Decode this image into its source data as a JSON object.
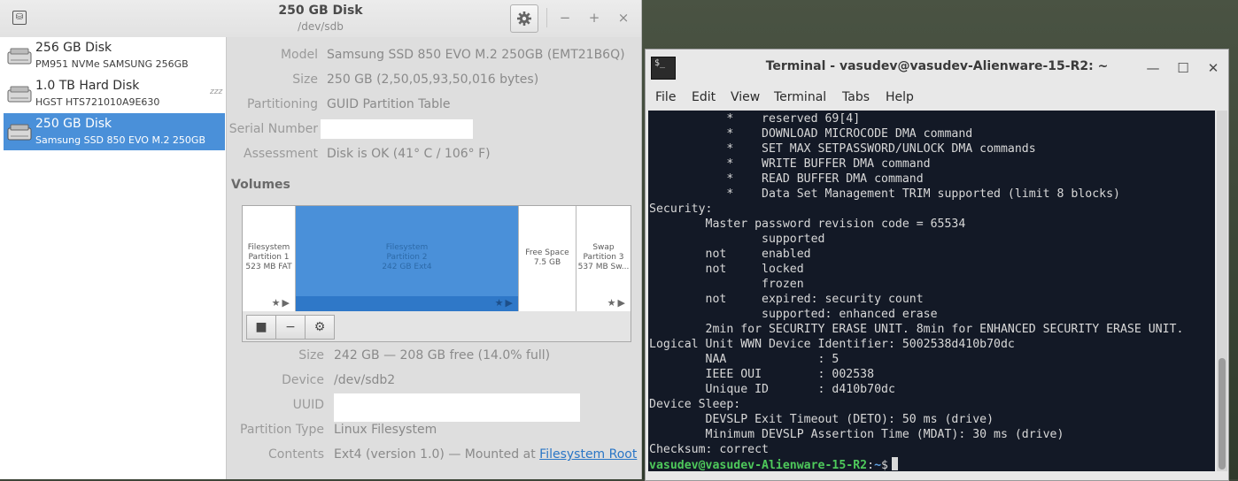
{
  "disks_window": {
    "title": "250 GB Disk",
    "subtitle": "/dev/sdb",
    "controls": {
      "minimize": "−",
      "maximize": "+",
      "close": "×"
    },
    "disk_list": [
      {
        "name": "256 GB Disk",
        "detail": "PM951 NVMe SAMSUNG 256GB"
      },
      {
        "name": "1.0 TB Hard Disk",
        "detail": "HGST HTS721010A9E630",
        "sleep_indicator": "zzz"
      },
      {
        "name": "250 GB Disk",
        "detail": "Samsung SSD 850 EVO M.2 250GB",
        "selected": true
      }
    ],
    "drive_properties": {
      "model_label": "Model",
      "model_value": "Samsung SSD 850 EVO M.2 250GB (EMT21B6Q)",
      "size_label": "Size",
      "size_value": "250 GB (2,50,05,93,50,016 bytes)",
      "partitioning_label": "Partitioning",
      "partitioning_value": "GUID Partition Table",
      "serial_label": "Serial Number",
      "assessment_label": "Assessment",
      "assessment_value": "Disk is OK (41° C / 106° F)"
    },
    "volumes_heading": "Volumes",
    "partitions": [
      {
        "line1": "Filesystem",
        "line2": "Partition 1",
        "line3": "523 MB FAT",
        "marks": "★▶"
      },
      {
        "line1": "Filesystem",
        "line2": "Partition 2",
        "line3": "242 GB Ext4",
        "marks": "★▶",
        "selected": true
      },
      {
        "line1": "Free Space",
        "line2": "7.5 GB",
        "line3": ""
      },
      {
        "line1": "Swap",
        "line2": "Partition 3",
        "line3": "537 MB Sw...",
        "marks": "★▶"
      }
    ],
    "volume_toolbar": {
      "stop": "■",
      "remove": "−",
      "options": "⚙"
    },
    "volume_properties": {
      "size_label": "Size",
      "size_value": "242 GB — 208 GB free (14.0% full)",
      "device_label": "Device",
      "device_value": "/dev/sdb2",
      "uuid_label": "UUID",
      "ptype_label": "Partition Type",
      "ptype_value": "Linux Filesystem",
      "contents_label": "Contents",
      "contents_value": "Ext4 (version 1.0) — Mounted at ",
      "contents_link": "Filesystem Root"
    }
  },
  "terminal_window": {
    "title": "Terminal - vasudev@vasudev-Alienware-15-R2: ~",
    "icon_text": "$_",
    "controls": {
      "minimize": "—",
      "maximize": "☐",
      "close": "✕"
    },
    "menu": [
      "File",
      "Edit",
      "View",
      "Terminal",
      "Tabs",
      "Help"
    ],
    "output_lines": [
      "           *    reserved 69[4]",
      "           *    DOWNLOAD MICROCODE DMA command",
      "           *    SET MAX SETPASSWORD/UNLOCK DMA commands",
      "           *    WRITE BUFFER DMA command",
      "           *    READ BUFFER DMA command",
      "           *    Data Set Management TRIM supported (limit 8 blocks)",
      "Security:",
      "        Master password revision code = 65534",
      "                supported",
      "        not     enabled",
      "        not     locked",
      "                frozen",
      "        not     expired: security count",
      "                supported: enhanced erase",
      "        2min for SECURITY ERASE UNIT. 8min for ENHANCED SECURITY ERASE UNIT.",
      "Logical Unit WWN Device Identifier: 5002538d410b70dc",
      "        NAA             : 5",
      "        IEEE OUI        : 002538",
      "        Unique ID       : d410b70dc",
      "Device Sleep:",
      "        DEVSLP Exit Timeout (DETO): 50 ms (drive)",
      "        Minimum DEVSLP Assertion Time (MDAT): 30 ms (drive)",
      "Checksum: correct"
    ],
    "prompt": {
      "user_host": "vasudev@vasudev-Alienware-15-R2",
      "colon": ":",
      "path": "~",
      "symbol": "$"
    }
  }
}
